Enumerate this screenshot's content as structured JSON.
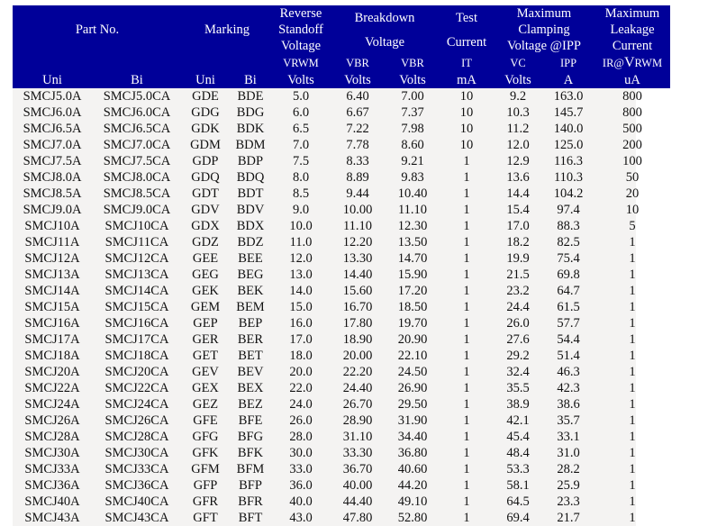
{
  "header": {
    "groups": {
      "part_no": "Part No.",
      "marking": "Marking",
      "reverse_standoff": [
        "Reverse",
        "Standoff",
        "Voltage"
      ],
      "breakdown": [
        "Breakdown",
        "Voltage"
      ],
      "test_current": [
        "Test",
        "Current"
      ],
      "max_clamping": [
        "Maximum",
        "Clamping",
        "Voltage @IPP"
      ],
      "max_leakage": [
        "Maximum",
        "Leakage",
        "Current"
      ]
    },
    "symbols": {
      "vrwm": "VRWM",
      "vbr_min": "VBR",
      "vbr_max": "VBR",
      "it": "IT",
      "vc": "VC",
      "ipp": "IPP",
      "ir_prefix": "IR@",
      "ir_v": "V",
      "ir_suffix": "RWM"
    },
    "units": {
      "uni": "Uni",
      "bi": "Bi",
      "mark_uni": "Uni",
      "mark_bi": "Bi",
      "vrwm": "Volts",
      "vbr_min": "Volts",
      "vbr_max": "Volts",
      "it": "mA",
      "vc": "Volts",
      "ipp": "A",
      "ir": "uA"
    }
  },
  "rows": [
    [
      "SMCJ5.0A",
      "SMCJ5.0CA",
      "GDE",
      "BDE",
      "5.0",
      "6.40",
      "7.00",
      "10",
      "9.2",
      "163.0",
      "800"
    ],
    [
      "SMCJ6.0A",
      "SMCJ6.0CA",
      "GDG",
      "BDG",
      "6.0",
      "6.67",
      "7.37",
      "10",
      "10.3",
      "145.7",
      "800"
    ],
    [
      "SMCJ6.5A",
      "SMCJ6.5CA",
      "GDK",
      "BDK",
      "6.5",
      "7.22",
      "7.98",
      "10",
      "11.2",
      "140.0",
      "500"
    ],
    [
      "SMCJ7.0A",
      "SMCJ7.0CA",
      "GDM",
      "BDM",
      "7.0",
      "7.78",
      "8.60",
      "10",
      "12.0",
      "125.0",
      "200"
    ],
    [
      "SMCJ7.5A",
      "SMCJ7.5CA",
      "GDP",
      "BDP",
      "7.5",
      "8.33",
      "9.21",
      "1",
      "12.9",
      "116.3",
      "100"
    ],
    [
      "SMCJ8.0A",
      "SMCJ8.0CA",
      "GDQ",
      "BDQ",
      "8.0",
      "8.89",
      "9.83",
      "1",
      "13.6",
      "110.3",
      "50"
    ],
    [
      "SMCJ8.5A",
      "SMCJ8.5CA",
      "GDT",
      "BDT",
      "8.5",
      "9.44",
      "10.40",
      "1",
      "14.4",
      "104.2",
      "20"
    ],
    [
      "SMCJ9.0A",
      "SMCJ9.0CA",
      "GDV",
      "BDV",
      "9.0",
      "10.00",
      "11.10",
      "1",
      "15.4",
      "97.4",
      "10"
    ],
    [
      "SMCJ10A",
      "SMCJ10CA",
      "GDX",
      "BDX",
      "10.0",
      "11.10",
      "12.30",
      "1",
      "17.0",
      "88.3",
      "5"
    ],
    [
      "SMCJ11A",
      "SMCJ11CA",
      "GDZ",
      "BDZ",
      "11.0",
      "12.20",
      "13.50",
      "1",
      "18.2",
      "82.5",
      "1"
    ],
    [
      "SMCJ12A",
      "SMCJ12CA",
      "GEE",
      "BEE",
      "12.0",
      "13.30",
      "14.70",
      "1",
      "19.9",
      "75.4",
      "1"
    ],
    [
      "SMCJ13A",
      "SMCJ13CA",
      "GEG",
      "BEG",
      "13.0",
      "14.40",
      "15.90",
      "1",
      "21.5",
      "69.8",
      "1"
    ],
    [
      "SMCJ14A",
      "SMCJ14CA",
      "GEK",
      "BEK",
      "14.0",
      "15.60",
      "17.20",
      "1",
      "23.2",
      "64.7",
      "1"
    ],
    [
      "SMCJ15A",
      "SMCJ15CA",
      "GEM",
      "BEM",
      "15.0",
      "16.70",
      "18.50",
      "1",
      "24.4",
      "61.5",
      "1"
    ],
    [
      "SMCJ16A",
      "SMCJ16CA",
      "GEP",
      "BEP",
      "16.0",
      "17.80",
      "19.70",
      "1",
      "26.0",
      "57.7",
      "1"
    ],
    [
      "SMCJ17A",
      "SMCJ17CA",
      "GER",
      "BER",
      "17.0",
      "18.90",
      "20.90",
      "1",
      "27.6",
      "54.4",
      "1"
    ],
    [
      "SMCJ18A",
      "SMCJ18CA",
      "GET",
      "BET",
      "18.0",
      "20.00",
      "22.10",
      "1",
      "29.2",
      "51.4",
      "1"
    ],
    [
      "SMCJ20A",
      "SMCJ20CA",
      "GEV",
      "BEV",
      "20.0",
      "22.20",
      "24.50",
      "1",
      "32.4",
      "46.3",
      "1"
    ],
    [
      "SMCJ22A",
      "SMCJ22CA",
      "GEX",
      "BEX",
      "22.0",
      "24.40",
      "26.90",
      "1",
      "35.5",
      "42.3",
      "1"
    ],
    [
      "SMCJ24A",
      "SMCJ24CA",
      "GEZ",
      "BEZ",
      "24.0",
      "26.70",
      "29.50",
      "1",
      "38.9",
      "38.6",
      "1"
    ],
    [
      "SMCJ26A",
      "SMCJ26CA",
      "GFE",
      "BFE",
      "26.0",
      "28.90",
      "31.90",
      "1",
      "42.1",
      "35.7",
      "1"
    ],
    [
      "SMCJ28A",
      "SMCJ28CA",
      "GFG",
      "BFG",
      "28.0",
      "31.10",
      "34.40",
      "1",
      "45.4",
      "33.1",
      "1"
    ],
    [
      "SMCJ30A",
      "SMCJ30CA",
      "GFK",
      "BFK",
      "30.0",
      "33.30",
      "36.80",
      "1",
      "48.4",
      "31.0",
      "1"
    ],
    [
      "SMCJ33A",
      "SMCJ33CA",
      "GFM",
      "BFM",
      "33.0",
      "36.70",
      "40.60",
      "1",
      "53.3",
      "28.2",
      "1"
    ],
    [
      "SMCJ36A",
      "SMCJ36CA",
      "GFP",
      "BFP",
      "36.0",
      "40.00",
      "44.20",
      "1",
      "58.1",
      "25.9",
      "1"
    ],
    [
      "SMCJ40A",
      "SMCJ40CA",
      "GFR",
      "BFR",
      "40.0",
      "44.40",
      "49.10",
      "1",
      "64.5",
      "23.3",
      "1"
    ],
    [
      "SMCJ43A",
      "SMCJ43CA",
      "GFT",
      "BFT",
      "43.0",
      "47.80",
      "52.80",
      "1",
      "69.4",
      "21.7",
      "1"
    ]
  ],
  "colors": {
    "header_bg": "#000099",
    "header_text": "#ffffff",
    "body_bg": "#f4f3f2"
  }
}
